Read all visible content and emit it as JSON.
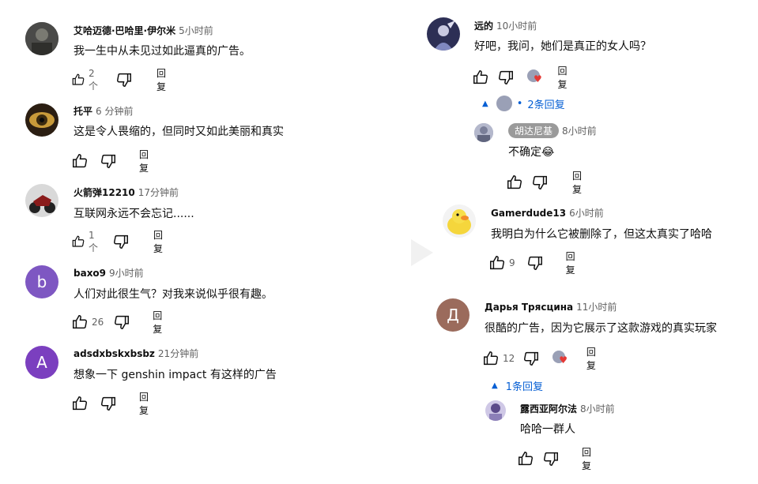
{
  "labels": {
    "reply": "回复"
  },
  "colors": {
    "accent_blue": "#065fd4",
    "heart_red": "#e53935",
    "avatar_b": "#7e57c2",
    "avatar_a": "#7b3fbf",
    "avatar_d": "#9b6b5c"
  },
  "left": [
    {
      "author": "艾哈迈德·巴哈里·伊尔米",
      "time": "5小时前",
      "text": "我一生中从未见过如此逼真的广告。",
      "likes": "2个"
    },
    {
      "author": "托平",
      "time": "6 分钟前",
      "text": "这是令人畏缩的，但同时又如此美丽和真实",
      "likes": ""
    },
    {
      "author": "火箭弹12210",
      "time": "17分钟前",
      "text": "互联网永远不会忘记......",
      "likes": "1个"
    },
    {
      "author": "baxo9",
      "time": "9小时前",
      "text": "人们对此很生气？对我来说似乎很有趣。",
      "likes": "26",
      "avatar_letter": "b"
    },
    {
      "author": "adsdxbskxbsbz",
      "time": "21分钟前",
      "text": "想象一下 genshin impact 有这样的广告",
      "likes": "",
      "avatar_letter": "A"
    }
  ],
  "right": {
    "c1": {
      "author": "远的",
      "time": "10小时前",
      "text": "好吧，我问，她们是真正的女人吗？",
      "replies_toggle": "2条回复"
    },
    "c1_reply": {
      "author": "胡达尼基",
      "time": "8小时前",
      "text": "不确定😂"
    },
    "c2": {
      "author": "Gamerdude13",
      "time": "6小时前",
      "text": "我明白为什么它被删除了，但这太真实了哈哈",
      "likes": "9"
    },
    "c3": {
      "author": "Дарья Трясцина",
      "time": "11小时前",
      "text": "很酷的广告，因为它展示了这款游戏的真实玩家",
      "likes": "12",
      "avatar_letter": "Д",
      "replies_toggle": "1条回复"
    },
    "c3_reply": {
      "author": "露西亚阿尔法",
      "time": "8小时前",
      "text": "哈哈一群人"
    }
  }
}
